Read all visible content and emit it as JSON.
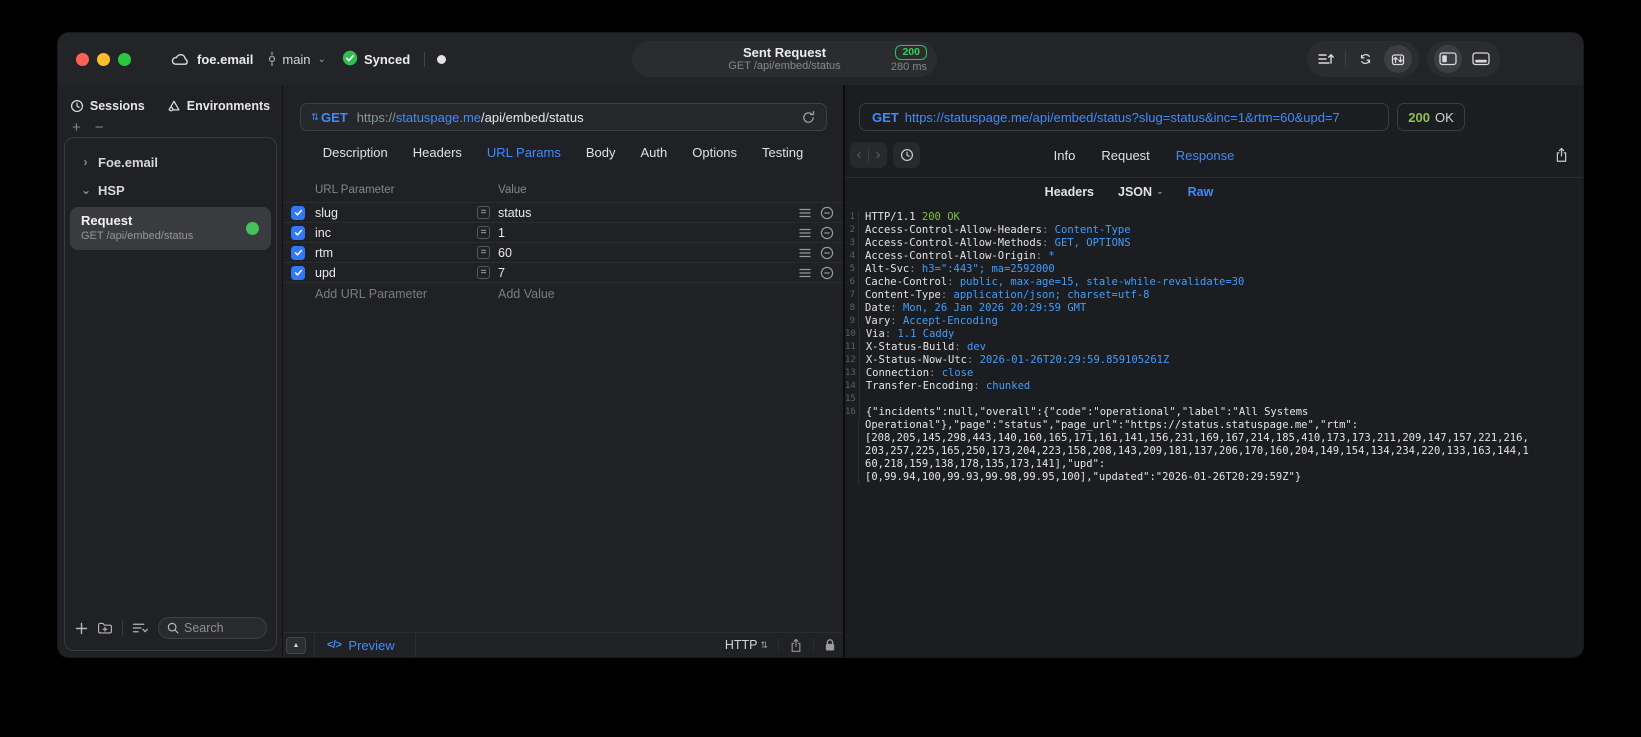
{
  "icons": {
    "chevron_right": "›",
    "chevron_down": "⌄",
    "updown": "⇅",
    "back": "‹",
    "forward": "›",
    "plus": "+",
    "minus": "−",
    "collapse_up": "▲",
    "code_tag": "</>"
  },
  "titlebar": {
    "project": "foe.email",
    "branch": "main",
    "sync_status": "Synced",
    "request_title": "Sent Request",
    "request_subtitle": "GET /api/embed/status",
    "status_code": "200",
    "duration": "280 ms"
  },
  "sidebar": {
    "tabs": [
      {
        "label": "Sessions"
      },
      {
        "label": "Environments"
      }
    ],
    "groups": [
      {
        "label": "Foe.email"
      },
      {
        "label": "HSP"
      }
    ],
    "request_item": {
      "title": "Request",
      "subtitle": "GET /api/embed/status"
    },
    "search_placeholder": "Search"
  },
  "editor": {
    "method": "GET",
    "url": {
      "scheme": "https://",
      "host": "statuspage.me",
      "path": "/api/embed/status"
    },
    "tabs": [
      "Description",
      "Headers",
      "URL Params",
      "Body",
      "Auth",
      "Options",
      "Testing"
    ],
    "active_tab": "URL Params",
    "params": {
      "columns": [
        "URL Parameter",
        "Value"
      ],
      "rows": [
        {
          "name": "slug",
          "value": "status",
          "enabled": true
        },
        {
          "name": "inc",
          "value": "1",
          "enabled": true
        },
        {
          "name": "rtm",
          "value": "60",
          "enabled": true
        },
        {
          "name": "upd",
          "value": "7",
          "enabled": true
        }
      ],
      "add_name": "Add URL Parameter",
      "add_value": "Add Value"
    },
    "footer": {
      "preview": "Preview",
      "protocol": "HTTP"
    }
  },
  "response": {
    "method": "GET",
    "url": "https://statuspage.me/api/embed/status?slug=status&inc=1&rtm=60&upd=7",
    "status_code": "200",
    "status_text": "OK",
    "tabs": [
      {
        "label": "Info"
      },
      {
        "label": "Request"
      },
      {
        "label": "Response",
        "active": true
      }
    ],
    "subtabs": [
      {
        "label": "Headers"
      },
      {
        "label": "JSON",
        "dropdown": true
      },
      {
        "label": "Raw",
        "active": true
      }
    ],
    "code_lines": [
      {
        "n": "1",
        "parts": [
          [
            "HTTP/1.1 ",
            "w"
          ],
          [
            "200 OK",
            "g"
          ]
        ]
      },
      {
        "n": "2",
        "parts": [
          [
            "Access-Control-Allow-Headers",
            "w"
          ],
          [
            ": ",
            "d"
          ],
          [
            "Content-Type",
            "b"
          ]
        ]
      },
      {
        "n": "3",
        "parts": [
          [
            "Access-Control-Allow-Methods",
            "w"
          ],
          [
            ": ",
            "d"
          ],
          [
            "GET, OPTIONS",
            "b"
          ]
        ]
      },
      {
        "n": "4",
        "parts": [
          [
            "Access-Control-Allow-Origin",
            "w"
          ],
          [
            ": ",
            "d"
          ],
          [
            "*",
            "b"
          ]
        ]
      },
      {
        "n": "5",
        "parts": [
          [
            "Alt-Svc",
            "w"
          ],
          [
            ": ",
            "d"
          ],
          [
            "h3=\":443\"; ma=2592000",
            "b"
          ]
        ]
      },
      {
        "n": "6",
        "parts": [
          [
            "Cache-Control",
            "w"
          ],
          [
            ": ",
            "d"
          ],
          [
            "public, max-age=15, stale-while-revalidate=30",
            "b"
          ]
        ]
      },
      {
        "n": "7",
        "parts": [
          [
            "Content-Type",
            "w"
          ],
          [
            ": ",
            "d"
          ],
          [
            "application/json; charset=utf-8",
            "b"
          ]
        ]
      },
      {
        "n": "8",
        "parts": [
          [
            "Date",
            "w"
          ],
          [
            ": ",
            "d"
          ],
          [
            "Mon, 26 Jan 2026 20:29:59 GMT",
            "b"
          ]
        ]
      },
      {
        "n": "9",
        "parts": [
          [
            "Vary",
            "w"
          ],
          [
            ": ",
            "d"
          ],
          [
            "Accept-Encoding",
            "b"
          ]
        ]
      },
      {
        "n": "10",
        "parts": [
          [
            "Via",
            "w"
          ],
          [
            ": ",
            "d"
          ],
          [
            "1.1 Caddy",
            "b"
          ]
        ]
      },
      {
        "n": "11",
        "parts": [
          [
            "X-Status-Build",
            "w"
          ],
          [
            ": ",
            "d"
          ],
          [
            "dev",
            "b"
          ]
        ]
      },
      {
        "n": "12",
        "parts": [
          [
            "X-Status-Now-Utc",
            "w"
          ],
          [
            ": ",
            "d"
          ],
          [
            "2026-01-26T20:29:59.859105261Z",
            "b"
          ]
        ]
      },
      {
        "n": "13",
        "parts": [
          [
            "Connection",
            "w"
          ],
          [
            ": ",
            "d"
          ],
          [
            "close",
            "b"
          ]
        ]
      },
      {
        "n": "14",
        "parts": [
          [
            "Transfer-Encoding",
            "w"
          ],
          [
            ": ",
            "d"
          ],
          [
            "chunked",
            "b"
          ]
        ]
      },
      {
        "n": "15",
        "parts": []
      },
      {
        "n": "16",
        "parts": [
          [
            "{\"incidents\":null,\"overall\":{\"code\":\"operational\",\"label\":\"All Systems",
            "w"
          ]
        ]
      },
      {
        "n": "",
        "parts": [
          [
            "Operational\"},\"page\":\"status\",\"page_url\":\"https://status.statuspage.me\",\"rtm\":",
            "w"
          ]
        ]
      },
      {
        "n": "",
        "parts": [
          [
            "[208,205,145,298,443,140,160,165,171,161,141,156,231,169,167,214,185,410,173,173,211,209,147,157,221,216,",
            "w"
          ]
        ]
      },
      {
        "n": "",
        "parts": [
          [
            "203,257,225,165,250,173,204,223,158,208,143,209,181,137,206,170,160,204,149,154,134,234,220,133,163,144,1",
            "w"
          ]
        ]
      },
      {
        "n": "",
        "parts": [
          [
            "60,218,159,138,178,135,173,141],\"upd\":",
            "w"
          ]
        ]
      },
      {
        "n": "",
        "parts": [
          [
            "[0,99.94,100,99.93,99.98,99.95,100],\"updated\":\"2026-01-26T20:29:59Z\"}",
            "w"
          ]
        ]
      }
    ]
  }
}
